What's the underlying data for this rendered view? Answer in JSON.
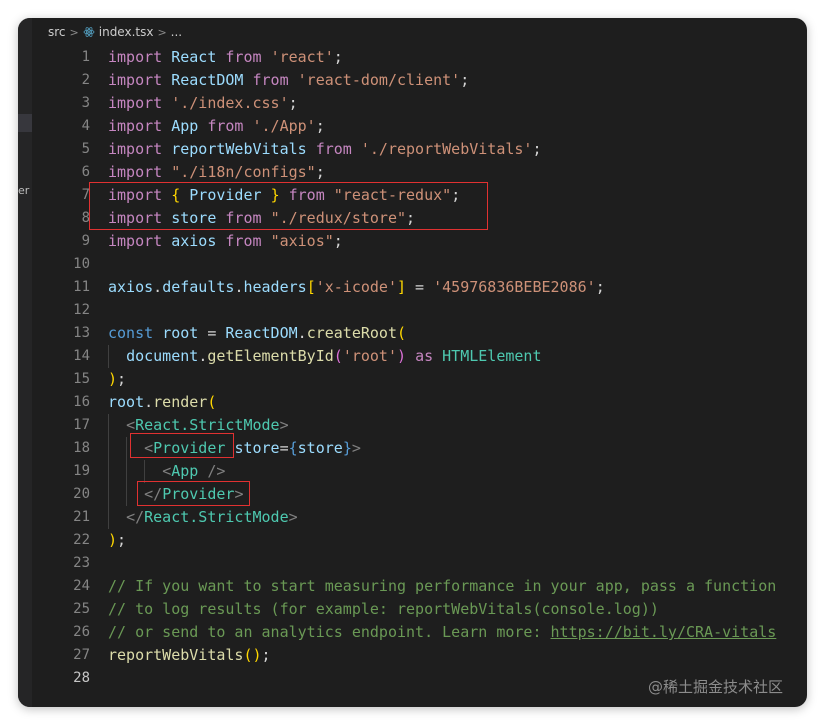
{
  "breadcrumb": {
    "folder": "src",
    "file": "index.tsx",
    "symbol": "..."
  },
  "sidebar_fragment": "er",
  "lines": [
    {
      "n": "1",
      "tokens": [
        [
          "k",
          "import"
        ],
        [
          "plain",
          " "
        ],
        [
          "id",
          "React"
        ],
        [
          "plain",
          " "
        ],
        [
          "k",
          "from"
        ],
        [
          "plain",
          " "
        ],
        [
          "s",
          "'react'"
        ],
        [
          "plain",
          ";"
        ]
      ]
    },
    {
      "n": "2",
      "tokens": [
        [
          "k",
          "import"
        ],
        [
          "plain",
          " "
        ],
        [
          "id",
          "ReactDOM"
        ],
        [
          "plain",
          " "
        ],
        [
          "k",
          "from"
        ],
        [
          "plain",
          " "
        ],
        [
          "s",
          "'react-dom/client'"
        ],
        [
          "plain",
          ";"
        ]
      ]
    },
    {
      "n": "3",
      "tokens": [
        [
          "k",
          "import"
        ],
        [
          "plain",
          " "
        ],
        [
          "s",
          "'./index.css'"
        ],
        [
          "plain",
          ";"
        ]
      ]
    },
    {
      "n": "4",
      "tokens": [
        [
          "k",
          "import"
        ],
        [
          "plain",
          " "
        ],
        [
          "id",
          "App"
        ],
        [
          "plain",
          " "
        ],
        [
          "k",
          "from"
        ],
        [
          "plain",
          " "
        ],
        [
          "s",
          "'./App'"
        ],
        [
          "plain",
          ";"
        ]
      ]
    },
    {
      "n": "5",
      "tokens": [
        [
          "k",
          "import"
        ],
        [
          "plain",
          " "
        ],
        [
          "id",
          "reportWebVitals"
        ],
        [
          "plain",
          " "
        ],
        [
          "k",
          "from"
        ],
        [
          "plain",
          " "
        ],
        [
          "s",
          "'./reportWebVitals'"
        ],
        [
          "plain",
          ";"
        ]
      ]
    },
    {
      "n": "6",
      "tokens": [
        [
          "k",
          "import"
        ],
        [
          "plain",
          " "
        ],
        [
          "s",
          "\"./i18n/configs\""
        ],
        [
          "plain",
          ";"
        ]
      ]
    },
    {
      "n": "7",
      "tokens": [
        [
          "k",
          "import"
        ],
        [
          "plain",
          " "
        ],
        [
          "b",
          "{"
        ],
        [
          "plain",
          " "
        ],
        [
          "id",
          "Provider"
        ],
        [
          "plain",
          " "
        ],
        [
          "b",
          "}"
        ],
        [
          "plain",
          " "
        ],
        [
          "k",
          "from"
        ],
        [
          "plain",
          " "
        ],
        [
          "s",
          "\"react-redux\""
        ],
        [
          "plain",
          ";"
        ]
      ]
    },
    {
      "n": "8",
      "tokens": [
        [
          "k",
          "import"
        ],
        [
          "plain",
          " "
        ],
        [
          "id",
          "store"
        ],
        [
          "plain",
          " "
        ],
        [
          "k",
          "from"
        ],
        [
          "plain",
          " "
        ],
        [
          "s",
          "\"./redux/store\""
        ],
        [
          "plain",
          ";"
        ]
      ]
    },
    {
      "n": "9",
      "tokens": [
        [
          "k",
          "import"
        ],
        [
          "plain",
          " "
        ],
        [
          "id",
          "axios"
        ],
        [
          "plain",
          " "
        ],
        [
          "k",
          "from"
        ],
        [
          "plain",
          " "
        ],
        [
          "s",
          "\"axios\""
        ],
        [
          "plain",
          ";"
        ]
      ]
    },
    {
      "n": "10",
      "tokens": []
    },
    {
      "n": "11",
      "tokens": [
        [
          "id",
          "axios"
        ],
        [
          "plain",
          "."
        ],
        [
          "id",
          "defaults"
        ],
        [
          "plain",
          "."
        ],
        [
          "id",
          "headers"
        ],
        [
          "b",
          "["
        ],
        [
          "s",
          "'x-icode'"
        ],
        [
          "b",
          "]"
        ],
        [
          "plain",
          " = "
        ],
        [
          "s",
          "'45976836BEBE2086'"
        ],
        [
          "plain",
          ";"
        ]
      ]
    },
    {
      "n": "12",
      "tokens": []
    },
    {
      "n": "13",
      "tokens": [
        [
          "brace",
          "const"
        ],
        [
          "plain",
          " "
        ],
        [
          "id",
          "root"
        ],
        [
          "plain",
          " = "
        ],
        [
          "id",
          "ReactDOM"
        ],
        [
          "plain",
          "."
        ],
        [
          "f",
          "createRoot"
        ],
        [
          "b",
          "("
        ]
      ]
    },
    {
      "n": "14",
      "tokens": [
        [
          "plain",
          "  "
        ],
        [
          "id",
          "document"
        ],
        [
          "plain",
          "."
        ],
        [
          "f",
          "getElementById"
        ],
        [
          "bp",
          "("
        ],
        [
          "s",
          "'root'"
        ],
        [
          "bp",
          ")"
        ],
        [
          "plain",
          " "
        ],
        [
          "k",
          "as"
        ],
        [
          "plain",
          " "
        ],
        [
          "t",
          "HTMLElement"
        ]
      ]
    },
    {
      "n": "15",
      "tokens": [
        [
          "b",
          ")"
        ],
        [
          "plain",
          ";"
        ]
      ]
    },
    {
      "n": "16",
      "tokens": [
        [
          "id",
          "root"
        ],
        [
          "plain",
          "."
        ],
        [
          "f",
          "render"
        ],
        [
          "b",
          "("
        ]
      ]
    },
    {
      "n": "17",
      "tokens": [
        [
          "plain",
          "  "
        ],
        [
          "ang",
          "<"
        ],
        [
          "tag",
          "React.StrictMode"
        ],
        [
          "ang",
          ">"
        ]
      ]
    },
    {
      "n": "18",
      "tokens": [
        [
          "plain",
          "    "
        ],
        [
          "ang",
          "<"
        ],
        [
          "tag",
          "Provider"
        ],
        [
          "plain",
          " "
        ],
        [
          "attr",
          "store"
        ],
        [
          "plain",
          "="
        ],
        [
          "brace",
          "{"
        ],
        [
          "id",
          "store"
        ],
        [
          "brace",
          "}"
        ],
        [
          "ang",
          ">"
        ]
      ]
    },
    {
      "n": "19",
      "tokens": [
        [
          "plain",
          "      "
        ],
        [
          "ang",
          "<"
        ],
        [
          "tag",
          "App"
        ],
        [
          "plain",
          " "
        ],
        [
          "ang",
          "/>"
        ]
      ]
    },
    {
      "n": "20",
      "tokens": [
        [
          "plain",
          "    "
        ],
        [
          "ang",
          "</"
        ],
        [
          "tag",
          "Provider"
        ],
        [
          "ang",
          ">"
        ]
      ]
    },
    {
      "n": "21",
      "tokens": [
        [
          "plain",
          "  "
        ],
        [
          "ang",
          "</"
        ],
        [
          "tag",
          "React.StrictMode"
        ],
        [
          "ang",
          ">"
        ]
      ]
    },
    {
      "n": "22",
      "tokens": [
        [
          "b",
          ")"
        ],
        [
          "plain",
          ";"
        ]
      ]
    },
    {
      "n": "23",
      "tokens": []
    },
    {
      "n": "24",
      "tokens": [
        [
          "c",
          "// If you want to start measuring performance in your app, pass a function"
        ]
      ]
    },
    {
      "n": "25",
      "tokens": [
        [
          "c",
          "// to log results (for example: reportWebVitals(console.log))"
        ]
      ]
    },
    {
      "n": "26",
      "tokens": [
        [
          "c",
          "// or send to an analytics endpoint. Learn more: "
        ],
        [
          "link",
          "https://bit.ly/CRA-vitals"
        ]
      ]
    },
    {
      "n": "27",
      "tokens": [
        [
          "f",
          "reportWebVitals"
        ],
        [
          "b",
          "("
        ],
        [
          "b",
          ")"
        ],
        [
          "plain",
          ";"
        ]
      ]
    },
    {
      "n": "28",
      "tokens": []
    }
  ],
  "current_line": "28",
  "watermark": "@稀土掘金技术社区",
  "colors": {
    "keyword": "#c586c0",
    "identifier": "#9cdcfe",
    "string": "#ce9178",
    "function": "#dcdcaa",
    "type": "#4ec9b0",
    "comment": "#6a9955",
    "highlight-box": "#e03131",
    "editor-bg": "#1e1e1e"
  }
}
